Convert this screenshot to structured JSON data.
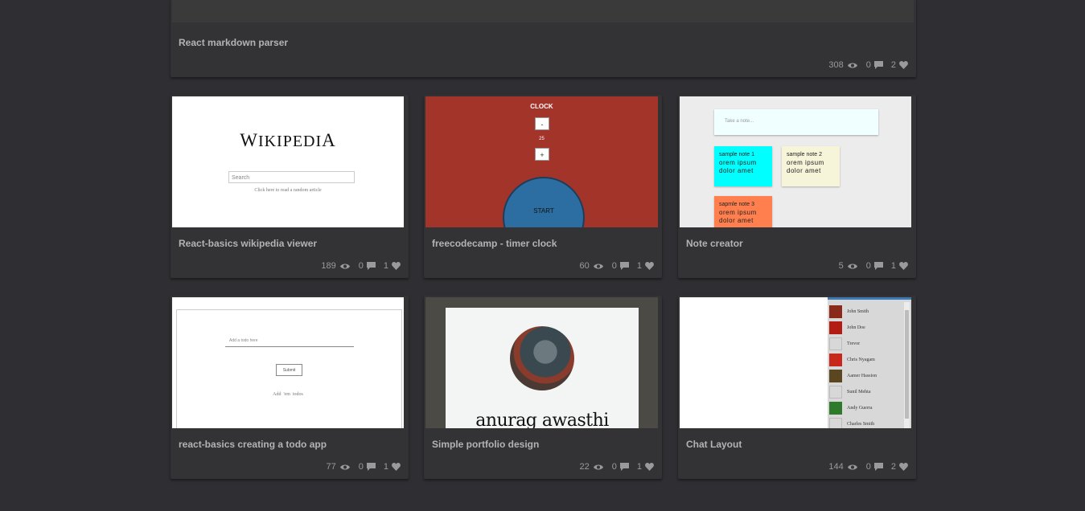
{
  "top_card": {
    "title": "React markdown parser",
    "views": "308",
    "comments": "0",
    "likes": "2"
  },
  "cards": [
    {
      "title": "React-basics wikipedia viewer",
      "views": "189",
      "comments": "0",
      "likes": "1",
      "preview": {
        "logo_first": "W",
        "logo_middle": "IKIPEDI",
        "logo_last": "A",
        "search_placeholder": "Search",
        "random_text": "Click here to read a random article"
      }
    },
    {
      "title": "freecodecamp - timer clock",
      "views": "60",
      "comments": "0",
      "likes": "1",
      "preview": {
        "heading": "CLOCK",
        "minus": "-",
        "value": "25",
        "plus": "+",
        "start": "START"
      }
    },
    {
      "title": "Note creator",
      "views": "5",
      "comments": "0",
      "likes": "1",
      "preview": {
        "placeholder": "Take a note...",
        "notes": [
          {
            "title": "sample note 1",
            "body1": "orem ipsum",
            "body2": "dolor amet",
            "color": "#00ffff"
          },
          {
            "title": "sample note 2",
            "body1": "orem ipsum",
            "body2": "dolor amet",
            "color": "#f6f4d9"
          },
          {
            "title": "sapmle note 3",
            "body1": "orem ipsum",
            "body2": "dolor amet",
            "color": "#ff7f4f"
          }
        ]
      }
    },
    {
      "title": "react-basics creating a todo app",
      "views": "77",
      "comments": "0",
      "likes": "1",
      "preview": {
        "placeholder": "Add a todo here",
        "submit": "Submit",
        "todos": "Add  'em  todos"
      }
    },
    {
      "title": "Simple portfolio design",
      "views": "22",
      "comments": "0",
      "likes": "1",
      "preview": {
        "name": "anurag awasthi"
      }
    },
    {
      "title": "Chat Layout",
      "views": "144",
      "comments": "0",
      "likes": "2",
      "preview": {
        "contacts": [
          "John Smith",
          "John Doe",
          "Trevor",
          "Chris Nyagam",
          "Aamer Hassion",
          "Sunil Mehta",
          "Andy Guerra",
          "Charles Smith"
        ]
      }
    }
  ]
}
